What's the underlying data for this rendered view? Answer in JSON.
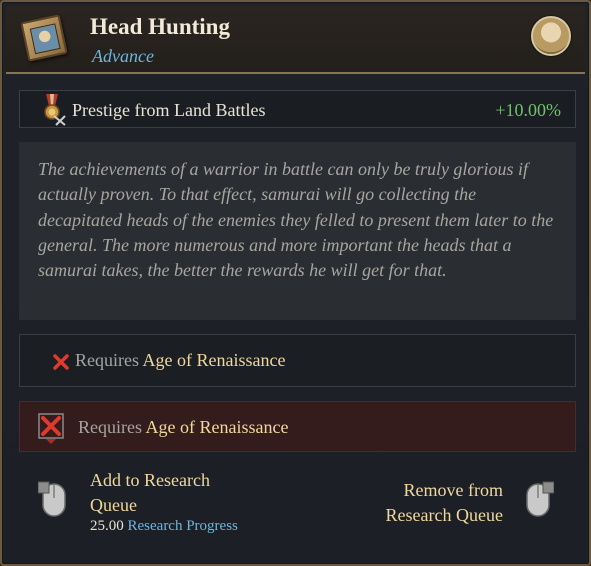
{
  "header": {
    "title": "Head Hunting",
    "subtitle": "Advance",
    "tech_icon": "scroll-portrait-icon",
    "advisor_icon": "advisor-portrait"
  },
  "effect": {
    "icon": "medal-swords-icon",
    "label": "Prestige from Land Battles",
    "value": "+10.00%",
    "value_color": "#6fc06a"
  },
  "description": "The achievements of a warrior in battle can only be truly glorious if actually proven. To that effect, samurai will go collecting the decapitated heads of the enemies they felled to present them later to the general. The more numerous and more important the heads that a samurai takes, the better the rewards he will get for that.",
  "requirements": [
    {
      "prefix": "Requires",
      "age": "Age of Renaissance",
      "icon": "x-mark-icon"
    },
    {
      "prefix": "Requires",
      "age": "Age of Renaissance",
      "icon": "x-mark-large-icon"
    }
  ],
  "actions": {
    "add_line1": "Add to Research",
    "add_line2": "Queue",
    "progress_value": "25.00",
    "progress_label": "Research Progress",
    "remove_line1": "Remove from",
    "remove_line2": "Research Queue"
  },
  "colors": {
    "accent_blue": "#6bb6e0",
    "gold_text": "#f0d79c",
    "positive": "#6fc06a",
    "frame": "#6b5a3f"
  }
}
